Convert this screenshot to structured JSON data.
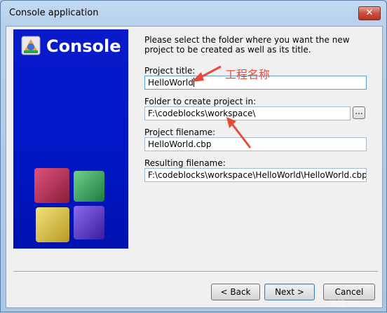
{
  "window": {
    "title": "Console application",
    "close_glyph": "✕"
  },
  "banner": {
    "title": "Console"
  },
  "intro": "Please select the folder where you want the new project to be created as well as its title.",
  "fields": {
    "project_title": {
      "label": "Project title:",
      "value": "HelloWorld"
    },
    "folder": {
      "label": "Folder to create project in:",
      "value": "F:\\codeblocks\\workspace\\"
    },
    "project_filename": {
      "label": "Project filename:",
      "value": "HelloWorld.cbp"
    },
    "resulting_filename": {
      "label": "Resulting filename:",
      "value": "F:\\codeblocks\\workspace\\HelloWorld\\HelloWorld.cbp"
    }
  },
  "browse_label": "...",
  "annotation": "工程名称",
  "buttons": {
    "back": "< Back",
    "next": "Next >",
    "cancel": "Cancel"
  },
  "watermark": "激活 Windows",
  "colors": {
    "annotation": "#e84a3a",
    "banner": "#0018c8"
  },
  "icons": {
    "logo": "codeblocks-logo-icon",
    "close": "close-icon"
  }
}
